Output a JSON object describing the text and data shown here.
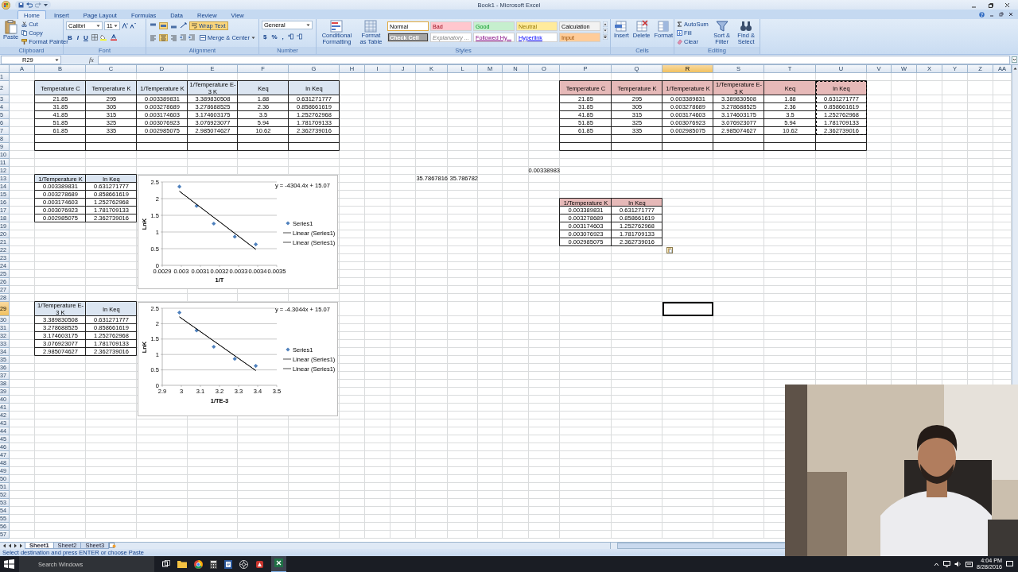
{
  "window": {
    "title": "Book1 - Microsoft Excel"
  },
  "ribbon": {
    "tabs": [
      {
        "label": "Home",
        "selected": true
      },
      {
        "label": "Insert",
        "selected": false
      },
      {
        "label": "Page Layout",
        "selected": false
      },
      {
        "label": "Formulas",
        "selected": false
      },
      {
        "label": "Data",
        "selected": false
      },
      {
        "label": "Review",
        "selected": false
      },
      {
        "label": "View",
        "selected": false
      }
    ],
    "clipboard": {
      "label": "Clipboard",
      "items": [
        "Paste",
        "Cut",
        "Copy",
        "Format Painter"
      ]
    },
    "font": {
      "label": "Font",
      "font_name": "Calibri",
      "font_size": "11",
      "buttons": [
        "B",
        "I",
        "U"
      ]
    },
    "alignment": {
      "label": "Alignment",
      "toggles": [
        {
          "on": false
        },
        {
          "on": true
        },
        {
          "on": false
        },
        {
          "on": false
        },
        {
          "on": true
        },
        {
          "on": false
        }
      ],
      "wrap_text": {
        "label": "Wrap Text",
        "on": true
      },
      "merge": "Merge & Center"
    },
    "number": {
      "label": "Number",
      "format": "General",
      "buttons": [
        "$",
        "%",
        ","
      ]
    },
    "styles": {
      "label": "Styles",
      "commands": [
        "Conditional Formatting",
        "Format as Table"
      ],
      "gallery": [
        {
          "label": "Normal",
          "kind": "plain",
          "color": "#ffffff",
          "selected": true
        },
        {
          "label": "Bad",
          "kind": "plain",
          "color": "#ffc7ce",
          "selected": false
        },
        {
          "label": "Good",
          "kind": "plain",
          "color": "#c6efce",
          "selected": false
        },
        {
          "label": "Neutral",
          "kind": "plain",
          "color": "#ffeb9c",
          "selected": false
        },
        {
          "label": "Calculation",
          "kind": "plain",
          "color": "#f2f2f2",
          "selected": false
        },
        {
          "label": "Check Cell",
          "kind": "check",
          "color": "#a5a5a5",
          "selected": false
        },
        {
          "label": "Explanatory ...",
          "kind": "note",
          "color": "#ffffff",
          "selected": false
        },
        {
          "label": "Followed Hy...",
          "kind": "visited-link",
          "color": "#ffffff",
          "selected": false
        },
        {
          "label": "Hyperlink",
          "kind": "link",
          "color": "#ffffff",
          "selected": false
        },
        {
          "label": "Input",
          "kind": "plain",
          "color": "#ffcc99",
          "selected": false
        }
      ]
    },
    "cells": {
      "label": "Cells",
      "items": [
        "Insert",
        "Delete",
        "Format"
      ]
    },
    "editing": {
      "label": "Editing",
      "items": [
        "AutoSum",
        "Fill",
        "Clear",
        "Sort & Filter",
        "Find & Select"
      ]
    }
  },
  "formula_bar": {
    "name_box": "R29",
    "function_button": "fx"
  },
  "sheet": {
    "columns": [
      {
        "label": "A",
        "selected": false
      },
      {
        "label": "B",
        "selected": false
      },
      {
        "label": "C",
        "selected": false
      },
      {
        "label": "D",
        "selected": false
      },
      {
        "label": "E",
        "selected": false
      },
      {
        "label": "F",
        "selected": false
      },
      {
        "label": "G",
        "selected": false
      },
      {
        "label": "H",
        "selected": false
      },
      {
        "label": "I",
        "selected": false
      },
      {
        "label": "J",
        "selected": false
      },
      {
        "label": "K",
        "selected": false
      },
      {
        "label": "L",
        "selected": false
      },
      {
        "label": "M",
        "selected": false
      },
      {
        "label": "N",
        "selected": false
      },
      {
        "label": "O",
        "selected": false
      },
      {
        "label": "P",
        "selected": false
      },
      {
        "label": "Q",
        "selected": false
      },
      {
        "label": "R",
        "selected": true
      },
      {
        "label": "S",
        "selected": false
      },
      {
        "label": "T",
        "selected": false
      },
      {
        "label": "U",
        "selected": false
      },
      {
        "label": "V",
        "selected": false
      },
      {
        "label": "W",
        "selected": false
      },
      {
        "label": "X",
        "selected": false
      },
      {
        "label": "Y",
        "selected": false
      },
      {
        "label": "Z",
        "selected": false
      },
      {
        "label": "AA",
        "selected": false
      }
    ],
    "rows": [
      {
        "label": "1",
        "selected": false
      },
      {
        "label": "2",
        "selected": false
      },
      {
        "label": "3",
        "selected": false
      },
      {
        "label": "4",
        "selected": false
      },
      {
        "label": "5",
        "selected": false
      },
      {
        "label": "6",
        "selected": false
      },
      {
        "label": "7",
        "selected": false
      },
      {
        "label": "8",
        "selected": false
      },
      {
        "label": "9",
        "selected": false
      },
      {
        "label": "10",
        "selected": false
      },
      {
        "label": "11",
        "selected": false
      },
      {
        "label": "12",
        "selected": false
      },
      {
        "label": "13",
        "selected": false
      },
      {
        "label": "14",
        "selected": false
      },
      {
        "label": "15",
        "selected": false
      },
      {
        "label": "16",
        "selected": false
      },
      {
        "label": "17",
        "selected": false
      },
      {
        "label": "18",
        "selected": false
      },
      {
        "label": "19",
        "selected": false
      },
      {
        "label": "20",
        "selected": false
      },
      {
        "label": "21",
        "selected": false
      },
      {
        "label": "22",
        "selected": false
      },
      {
        "label": "23",
        "selected": false
      },
      {
        "label": "24",
        "selected": false
      },
      {
        "label": "25",
        "selected": false
      },
      {
        "label": "26",
        "selected": false
      },
      {
        "label": "27",
        "selected": false
      },
      {
        "label": "28",
        "selected": false
      },
      {
        "label": "29",
        "selected": true
      },
      {
        "label": "30",
        "selected": false
      },
      {
        "label": "31",
        "selected": false
      },
      {
        "label": "32",
        "selected": false
      },
      {
        "label": "33",
        "selected": false
      },
      {
        "label": "34",
        "selected": false
      },
      {
        "label": "35",
        "selected": false
      },
      {
        "label": "36",
        "selected": false
      },
      {
        "label": "37",
        "selected": false
      },
      {
        "label": "38",
        "selected": false
      },
      {
        "label": "39",
        "selected": false
      },
      {
        "label": "40",
        "selected": false
      },
      {
        "label": "41",
        "selected": false
      },
      {
        "label": "42",
        "selected": false
      },
      {
        "label": "43",
        "selected": false
      },
      {
        "label": "44",
        "selected": false
      },
      {
        "label": "45",
        "selected": false
      },
      {
        "label": "46",
        "selected": false
      },
      {
        "label": "47",
        "selected": false
      },
      {
        "label": "48",
        "selected": false
      },
      {
        "label": "49",
        "selected": false
      },
      {
        "label": "50",
        "selected": false
      },
      {
        "label": "51",
        "selected": false
      },
      {
        "label": "52",
        "selected": false
      },
      {
        "label": "53",
        "selected": false
      },
      {
        "label": "54",
        "selected": false
      },
      {
        "label": "55",
        "selected": false
      },
      {
        "label": "56",
        "selected": false
      },
      {
        "label": "57",
        "selected": false
      }
    ],
    "tables": [
      {
        "color": "#dbe5f1",
        "columns": [
          {
            "label": "Temperature C",
            "copied": false
          },
          {
            "label": "Temperature K",
            "copied": false
          },
          {
            "label": "1/Temperature K",
            "copied": false
          },
          {
            "label": "1/Temperature E-3 K",
            "copied": false
          },
          {
            "label": "Keq",
            "copied": false
          },
          {
            "label": "ln Keq",
            "copied": false
          }
        ],
        "rows": [
          [
            "21.85",
            "295",
            "0.003389831",
            "3.389830508",
            "1.88",
            "0.631271777"
          ],
          [
            "31.85",
            "305",
            "0.003278689",
            "3.278688525",
            "2.36",
            "0.858661619"
          ],
          [
            "41.85",
            "315",
            "0.003174603",
            "3.174603175",
            "3.5",
            "1.252762968"
          ],
          [
            "51.85",
            "325",
            "0.003076923",
            "3.076923077",
            "5.94",
            "1.781709133"
          ],
          [
            "61.85",
            "335",
            "0.002985075",
            "2.985074627",
            "10.62",
            "2.362739016"
          ]
        ]
      },
      {
        "color": "#dbe5f1",
        "columns": [
          {
            "label": "1/Temperature K",
            "copied": false
          },
          {
            "label": "ln Keq",
            "copied": false
          }
        ],
        "rows": [
          [
            "0.003389831",
            "0.631271777"
          ],
          [
            "0.003278689",
            "0.858661619"
          ],
          [
            "0.003174603",
            "1.252762968"
          ],
          [
            "0.003076923",
            "1.781709133"
          ],
          [
            "0.002985075",
            "2.362739016"
          ]
        ]
      },
      {
        "color": "#dbe5f1",
        "columns": [
          {
            "label": "1/Temperature E-3 K",
            "copied": false
          },
          {
            "label": "ln Keq",
            "copied": false
          }
        ],
        "rows": [
          [
            "3.389830508",
            "0.631271777"
          ],
          [
            "3.278688525",
            "0.858661619"
          ],
          [
            "3.174603175",
            "1.252762968"
          ],
          [
            "3.076923077",
            "1.781709133"
          ],
          [
            "2.985074627",
            "2.362739016"
          ]
        ]
      },
      {
        "color": "#e6b9b8",
        "columns": [
          {
            "label": "Temperature C",
            "copied": false
          },
          {
            "label": "Temperature K",
            "copied": false
          },
          {
            "label": "1/Temperature K",
            "copied": false
          },
          {
            "label": "1/Temperature E-3 K",
            "copied": false
          },
          {
            "label": "Keq",
            "copied": false
          },
          {
            "label": "ln Keq",
            "copied": true
          }
        ],
        "rows": [
          [
            "21.85",
            "295",
            "0.003389831",
            "3.389830508",
            "1.88",
            "0.631271777"
          ],
          [
            "31.85",
            "305",
            "0.003278689",
            "3.278688525",
            "2.36",
            "0.858661619"
          ],
          [
            "41.85",
            "315",
            "0.003174603",
            "3.174603175",
            "3.5",
            "1.252762968"
          ],
          [
            "51.85",
            "325",
            "0.003076923",
            "3.076923077",
            "5.94",
            "1.781709133"
          ],
          [
            "61.85",
            "335",
            "0.002985075",
            "2.985074627",
            "10.62",
            "2.362739016"
          ]
        ]
      },
      {
        "color": "#e6b9b8",
        "columns": [
          {
            "label": "1/Temperature K",
            "copied": false
          },
          {
            "label": "ln Keq",
            "copied": false
          }
        ],
        "rows": [
          [
            "0.003389831",
            "0.631271777"
          ],
          [
            "0.003278689",
            "0.858661619"
          ],
          [
            "0.003174603",
            "1.252762968"
          ],
          [
            "0.003076923",
            "1.781709133"
          ],
          [
            "0.002985075",
            "2.362739016"
          ]
        ]
      }
    ],
    "cells": [
      {
        "value": "0.00338983"
      },
      {
        "value": "35.7867816"
      },
      {
        "value": "35.786782"
      }
    ],
    "charts": [
      {
        "chart_data": {
          "type": "scatter",
          "xlabel": "1/T",
          "ylabel": "LnK",
          "grid": true,
          "legend": true,
          "series": [
            {
              "name": "Series1",
              "color": "#4f81bd",
              "x": [
                0.00339,
                0.00328,
                0.00317,
                0.00308,
                0.00299
              ],
              "values": [
                0.63,
                0.86,
                1.25,
                1.78,
                2.36
              ]
            },
            {
              "name": "Linear (Series1)",
              "type": "line",
              "color": "#000000",
              "x": [
                0.00299,
                0.00339
              ],
              "values": [
                2.22,
                0.48
              ]
            },
            {
              "name": "Linear (Series1)",
              "type": "line",
              "color": "#000000",
              "x": [
                0.00299,
                0.00339
              ],
              "values": [
                2.22,
                0.48
              ]
            }
          ],
          "xlim": [
            0.0029,
            0.0035
          ],
          "ylim": [
            0,
            2.5
          ],
          "xticks": [
            {
              "value": 0.0029,
              "label": "0.0029"
            },
            {
              "value": 0.003,
              "label": "0.003"
            },
            {
              "value": 0.0031,
              "label": "0.0031"
            },
            {
              "value": 0.0032,
              "label": "0.0032"
            },
            {
              "value": 0.0033,
              "label": "0.0033"
            },
            {
              "value": 0.0034,
              "label": "0.0034"
            },
            {
              "value": 0.0035,
              "label": "0.0035"
            }
          ],
          "yticks": [
            {
              "value": 0,
              "label": "0"
            },
            {
              "value": 0.5,
              "label": "0.5"
            },
            {
              "value": 1,
              "label": "1"
            },
            {
              "value": 1.5,
              "label": "1.5"
            },
            {
              "value": 2,
              "label": "2"
            },
            {
              "value": 2.5,
              "label": "2.5"
            }
          ],
          "annotations": [
            "y = -4304.4x + 15.07"
          ]
        }
      },
      {
        "chart_data": {
          "type": "scatter",
          "xlabel": "1/TE-3",
          "ylabel": "LnK",
          "grid": true,
          "legend": true,
          "series": [
            {
              "name": "Series1",
              "color": "#4f81bd",
              "x": [
                3.39,
                3.28,
                3.17,
                3.08,
                2.99
              ],
              "values": [
                0.63,
                0.86,
                1.25,
                1.78,
                2.36
              ]
            },
            {
              "name": "Linear (Series1)",
              "type": "line",
              "color": "#000000",
              "x": [
                2.99,
                3.39
              ],
              "values": [
                2.22,
                0.48
              ]
            },
            {
              "name": "Linear (Series1)",
              "type": "line",
              "color": "#000000",
              "x": [
                2.99,
                3.39
              ],
              "values": [
                2.22,
                0.48
              ]
            }
          ],
          "xlim": [
            2.9,
            3.5
          ],
          "ylim": [
            0,
            2.5
          ],
          "xticks": [
            {
              "value": 2.9,
              "label": "2.9"
            },
            {
              "value": 3,
              "label": "3"
            },
            {
              "value": 3.1,
              "label": "3.1"
            },
            {
              "value": 3.2,
              "label": "3.2"
            },
            {
              "value": 3.3,
              "label": "3.3"
            },
            {
              "value": 3.4,
              "label": "3.4"
            },
            {
              "value": 3.5,
              "label": "3.5"
            }
          ],
          "yticks": [
            {
              "value": 0,
              "label": "0"
            },
            {
              "value": 0.5,
              "label": "0.5"
            },
            {
              "value": 1,
              "label": "1"
            },
            {
              "value": 1.5,
              "label": "1.5"
            },
            {
              "value": 2,
              "label": "2"
            },
            {
              "value": 2.5,
              "label": "2.5"
            }
          ],
          "annotations": [
            "y = -4.3044x + 15.07"
          ]
        }
      }
    ]
  },
  "sheet_tabs": [
    {
      "label": "Sheet1",
      "selected": true
    },
    {
      "label": "Sheet2",
      "selected": false
    },
    {
      "label": "Sheet3",
      "selected": false
    }
  ],
  "status_bar": {
    "message": "Select destination and press ENTER or choose Paste"
  },
  "taskbar": {
    "search": {
      "placeholder": "Search Windows"
    },
    "time": "4:04 PM",
    "date": "8/28/2016"
  }
}
